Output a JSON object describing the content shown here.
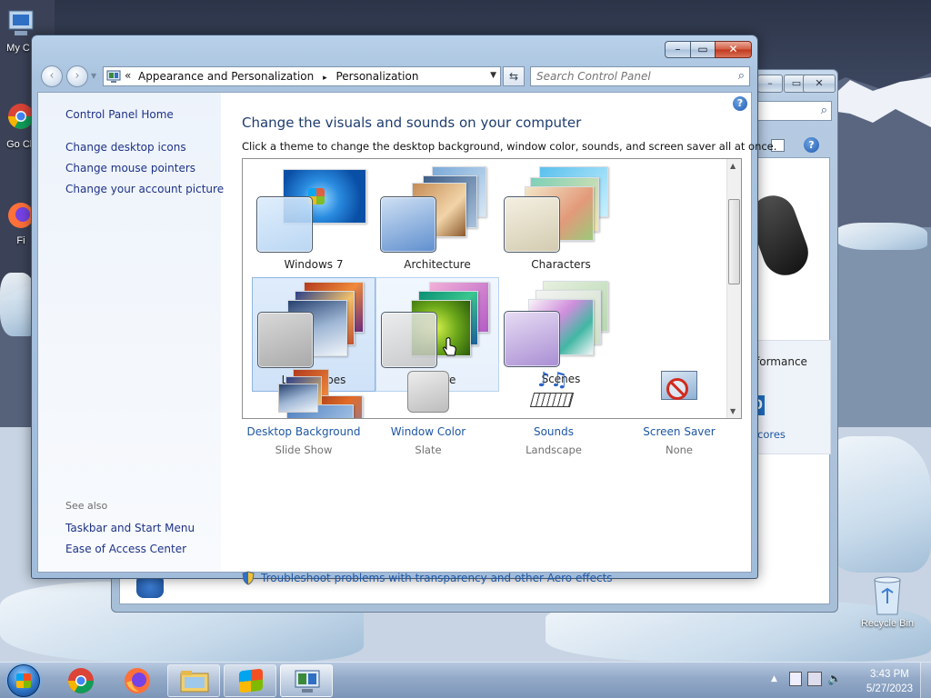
{
  "desktop": {
    "icons": [
      {
        "label": "My C"
      },
      {
        "label": "Go Ch"
      },
      {
        "label": "Fi"
      },
      {
        "label": "Recycle Bin"
      }
    ],
    "bg_window": {
      "perf_text": "formance",
      "perf_badge": "0",
      "scores_text": "scores"
    }
  },
  "window": {
    "controls": {
      "minimize": "–",
      "maximize": "▭",
      "close": "✕"
    },
    "nav": {
      "back": "‹",
      "forward": "›"
    },
    "address": {
      "overflow": "«",
      "crumbs": [
        "Appearance and Personalization",
        "Personalization"
      ],
      "separator": "▸"
    },
    "search": {
      "placeholder": "Search Control Panel"
    },
    "left_pane": {
      "home": "Control Panel Home",
      "links": [
        "Change desktop icons",
        "Change mouse pointers",
        "Change your account picture"
      ],
      "see_also_title": "See also",
      "see_also": [
        "Taskbar and Start Menu",
        "Ease of Access Center"
      ]
    },
    "main": {
      "title": "Change the visuals and sounds on your computer",
      "subtitle": "Click a theme to change the desktop background, window color, sounds, and screen saver all at once.",
      "themes": [
        {
          "name": "Windows 7"
        },
        {
          "name": "Architecture"
        },
        {
          "name": "Characters"
        },
        {
          "name": "Landscapes"
        },
        {
          "name": "Nature"
        },
        {
          "name": "Scenes"
        }
      ],
      "bottom": [
        {
          "title": "Desktop Background",
          "value": "Slide Show"
        },
        {
          "title": "Window Color",
          "value": "Slate"
        },
        {
          "title": "Sounds",
          "value": "Landscape"
        },
        {
          "title": "Screen Saver",
          "value": "None"
        }
      ],
      "troubleshoot": "Troubleshoot problems with transparency and other Aero effects"
    }
  },
  "taskbar": {
    "clock": {
      "time": "3:43 PM",
      "date": "5/27/2023"
    }
  },
  "colors": {
    "link": "#1e57a4",
    "title": "#1e3d6e",
    "selection": "#cfe2f8"
  }
}
